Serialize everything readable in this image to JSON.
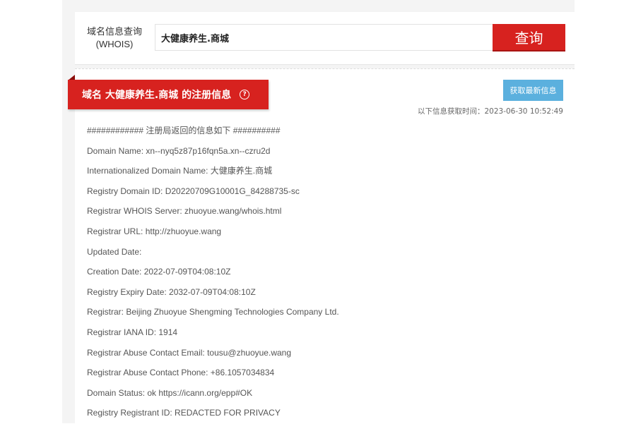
{
  "search": {
    "label_line1": "域名信息查询",
    "label_line2": "(WHOIS)",
    "value": "大健康养生.商城",
    "button_label": "查询"
  },
  "result": {
    "title": "域名 大健康养生.商城 的注册信息",
    "help_icon": "question-circle-icon",
    "refresh_label": "获取最新信息",
    "fetch_time": "以下信息获取时间：2023-06-30 10:52:49"
  },
  "whois_lines": [
    "############ 注册局返回的信息如下 ##########",
    "Domain Name: xn--nyq5z87p16fqn5a.xn--czru2d",
    "Internationalized Domain Name: 大健康养生.商城",
    "Registry Domain ID: D20220709G10001G_84288735-sc",
    "Registrar WHOIS Server: zhuoyue.wang/whois.html",
    "Registrar URL: http://zhuoyue.wang",
    "Updated Date:",
    "Creation Date: 2022-07-09T04:08:10Z",
    "Registry Expiry Date: 2032-07-09T04:08:10Z",
    "Registrar: Beijing Zhuoyue Shengming Technologies Company Ltd.",
    "Registrar IANA ID: 1914",
    "Registrar Abuse Contact Email: tousu@zhuoyue.wang",
    "Registrar Abuse Contact Phone: +86.1057034834",
    "Domain Status: ok https://icann.org/epp#OK",
    "Registry Registrant ID: REDACTED FOR PRIVACY"
  ],
  "colors": {
    "accent_red": "#d7221f",
    "button_blue": "#5bb0de",
    "page_bg": "#f4f4f4"
  }
}
